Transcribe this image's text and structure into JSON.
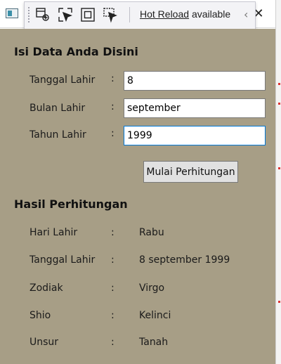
{
  "hot_reload": {
    "link_text": "Hot Reload",
    "status_text": "available",
    "icons": [
      "live-visual-tree-icon",
      "select-element-icon",
      "display-layout-adorners-icon",
      "track-focus-icon"
    ]
  },
  "window": {
    "close_glyph": "✕"
  },
  "form": {
    "title": "Isi Data Anda Disini",
    "colon": ":",
    "fields": [
      {
        "label": "Tanggal Lahir",
        "value": "8"
      },
      {
        "label": "Bulan Lahir",
        "value": "september"
      },
      {
        "label": "Tahun Lahir",
        "value": "1999"
      }
    ],
    "submit_label": "Mulai Perhitungan"
  },
  "results": {
    "title": "Hasil Perhitungan",
    "colon": ":",
    "rows": [
      {
        "label": "Hari Lahir",
        "value": "Rabu"
      },
      {
        "label": "Tanggal Lahir",
        "value": "8 september 1999"
      },
      {
        "label": "Zodiak",
        "value": "Virgo"
      },
      {
        "label": "Shio",
        "value": "Kelinci"
      },
      {
        "label": "Unsur",
        "value": "Tanah"
      }
    ]
  },
  "colors": {
    "form_background": "#a79e86",
    "focus_border": "#0078d7"
  }
}
